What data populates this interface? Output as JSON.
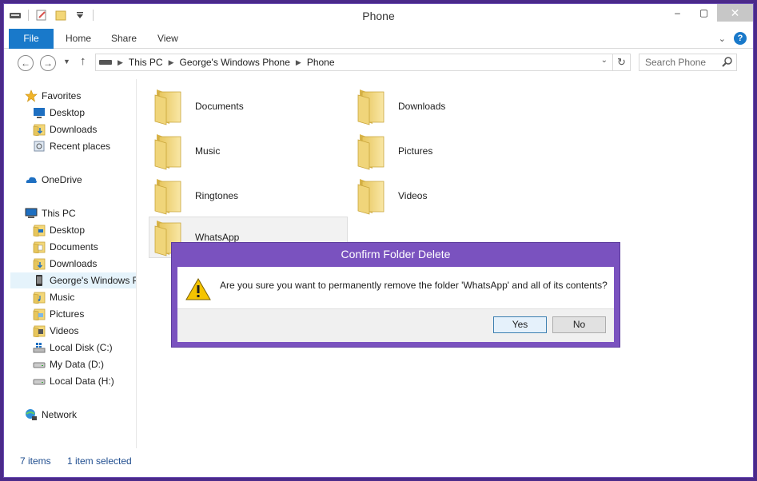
{
  "window": {
    "title": "Phone"
  },
  "ribbon": {
    "tabs": [
      "File",
      "Home",
      "Share",
      "View"
    ]
  },
  "address": {
    "segments": [
      "This PC",
      "George's Windows Phone",
      "Phone"
    ]
  },
  "search": {
    "placeholder": "Search Phone"
  },
  "navpane": {
    "favorites": {
      "label": "Favorites",
      "items": [
        "Desktop",
        "Downloads",
        "Recent places"
      ]
    },
    "onedrive": "OneDrive",
    "thispc": {
      "label": "This PC",
      "items": [
        "Desktop",
        "Documents",
        "Downloads",
        "George's Windows P",
        "Music",
        "Pictures",
        "Videos",
        "Local Disk (C:)",
        "My Data (D:)",
        "Local Data  (H:)"
      ]
    },
    "network": "Network"
  },
  "folders": [
    "Documents",
    "Downloads",
    "Music",
    "Pictures",
    "Ringtones",
    "Videos",
    "WhatsApp"
  ],
  "status": {
    "count": "7 items",
    "selected": "1 item selected"
  },
  "dialog": {
    "title": "Confirm Folder Delete",
    "message": "Are you sure you want to permanently remove the folder 'WhatsApp' and all of its contents?",
    "yes": "Yes",
    "no": "No"
  },
  "colors": {
    "accent": "#1979ca",
    "dialog_frame": "#7a52bf",
    "desktop": "#4b2a8a"
  },
  "icons": [
    "folder-icon",
    "star-icon",
    "desktop-icon",
    "recent-places-icon",
    "onedrive-icon",
    "this-pc-icon",
    "phone-icon",
    "drive-icon",
    "network-icon",
    "warning-icon",
    "search-icon",
    "help-icon"
  ]
}
